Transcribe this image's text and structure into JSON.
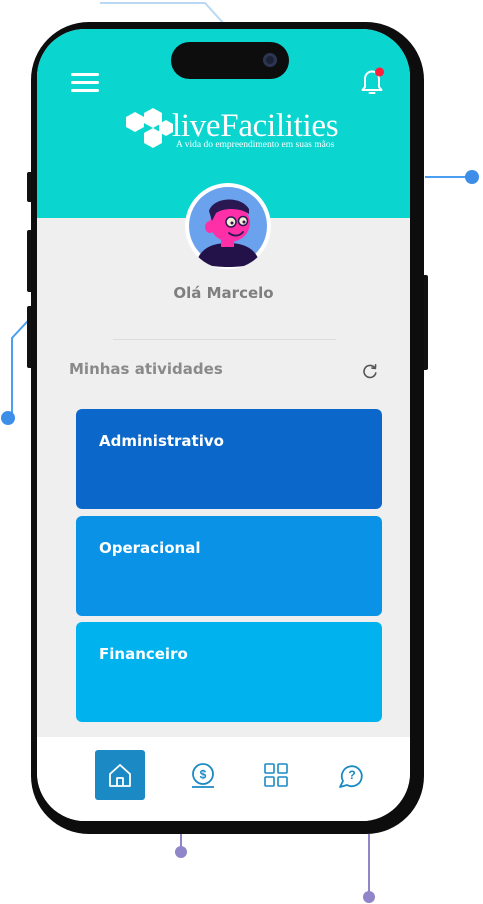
{
  "app": {
    "brand_name": "liveFacilities",
    "tagline": "A vida do empreendimento em suas mãos"
  },
  "user": {
    "greeting": "Olá Marcelo"
  },
  "activities": {
    "title": "Minhas atividades",
    "cards": [
      {
        "label": "Administrativo",
        "color": "#0b67c9"
      },
      {
        "label": "Operacional",
        "color": "#0a92e6"
      },
      {
        "label": "Financeiro",
        "color": "#00b2ee"
      }
    ]
  },
  "bottom_nav": [
    {
      "icon": "home-icon",
      "active": true
    },
    {
      "icon": "money-icon",
      "active": false
    },
    {
      "icon": "grid-icon",
      "active": false
    },
    {
      "icon": "help-chat-icon",
      "active": false
    }
  ],
  "colors": {
    "header": "#0ad5cf",
    "nav_active": "#1b8ac4",
    "accent_line": "#4a9ff0",
    "notification_dot": "#ff1f3d"
  }
}
